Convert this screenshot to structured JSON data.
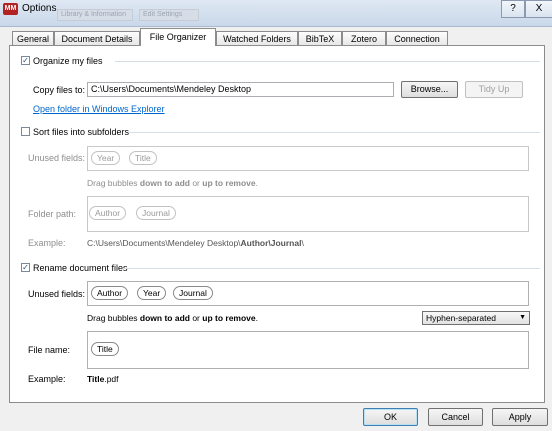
{
  "window": {
    "title": "Options",
    "app_icon_text": "MM",
    "help_label": "?",
    "close_label": "X",
    "blurred_tabs": [
      "Library & Information",
      "Edit Settings"
    ]
  },
  "tabs": [
    {
      "label": "General"
    },
    {
      "label": "Document Details"
    },
    {
      "label": "File Organizer"
    },
    {
      "label": "Watched Folders"
    },
    {
      "label": "BibTeX"
    },
    {
      "label": "Zotero"
    },
    {
      "label": "Connection"
    }
  ],
  "organize": {
    "checkbox_label": "Organize my files",
    "checked": true,
    "copy_label": "Copy files to:",
    "copy_path": "C:\\Users\\Documents\\Mendeley Desktop",
    "browse_label": "Browse...",
    "tidy_label": "Tidy Up",
    "open_link": "Open folder in Windows Explorer"
  },
  "sort": {
    "checkbox_label": "Sort files into subfolders",
    "checked": false,
    "unused_label": "Unused fields:",
    "unused_bubbles": [
      "Year",
      "Title"
    ],
    "hint_prefix": "Drag bubbles ",
    "hint_down": "down to add",
    "hint_mid": " or ",
    "hint_up": "up to remove",
    "hint_end": ".",
    "folder_label": "Folder path:",
    "folder_bubbles": [
      "Author",
      "Journal"
    ],
    "example_label": "Example:",
    "example_base": "C:\\Users\\Documents\\Mendeley Desktop\\",
    "example_bold": "Author\\Journal",
    "example_end": "\\"
  },
  "rename": {
    "checkbox_label": "Rename document files",
    "checked": true,
    "unused_label": "Unused fields:",
    "unused_bubbles": [
      "Author",
      "Year",
      "Journal"
    ],
    "hint_prefix": "Drag bubbles ",
    "hint_down": "down to add",
    "hint_mid": " or ",
    "hint_up": "up to remove",
    "hint_end": ".",
    "separator_value": "Hyphen-separated",
    "filename_label": "File name:",
    "filename_bubbles": [
      "Title"
    ],
    "example_label": "Example:",
    "example_bold": "Title",
    "example_ext": ".pdf"
  },
  "buttons": {
    "ok": "OK",
    "cancel": "Cancel",
    "apply": "Apply"
  }
}
